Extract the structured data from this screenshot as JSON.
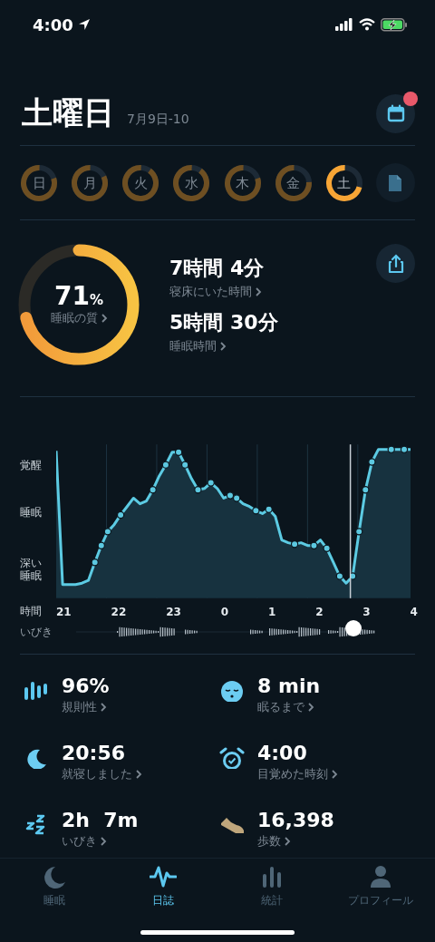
{
  "status_bar": {
    "time": "4:00"
  },
  "header": {
    "title": "土曜日",
    "date_range": "7月9日-10",
    "calendar_badge": true
  },
  "days": [
    {
      "label": "日",
      "selected": false
    },
    {
      "label": "月",
      "selected": false
    },
    {
      "label": "火",
      "selected": false
    },
    {
      "label": "水",
      "selected": false
    },
    {
      "label": "木",
      "selected": false
    },
    {
      "label": "金",
      "selected": false
    },
    {
      "label": "土",
      "selected": true
    }
  ],
  "summary": {
    "quality": {
      "value": "71",
      "unit": "%",
      "label": "睡眠の質"
    },
    "stats": [
      {
        "value": "7時間 4分",
        "label": "寝床にいた時間"
      },
      {
        "value": "5時間 30分",
        "label": "睡眠時間"
      }
    ]
  },
  "hypnogram": {
    "y_labels": [
      "覚醒",
      "睡眠",
      "深い睡眠"
    ],
    "x_title": "時間",
    "x_labels": [
      "21",
      "22",
      "23",
      "0",
      "1",
      "2",
      "3",
      "4"
    ],
    "snore_label": "いびき"
  },
  "metrics": [
    {
      "value": "96%",
      "label": "規則性"
    },
    {
      "value": "8 min",
      "label": "眠るまで"
    },
    {
      "value": "20:56",
      "label": "就寝しました"
    },
    {
      "value": "4:00",
      "label": "目覚めた時刻"
    },
    {
      "value": "2h  7m",
      "label": "いびき"
    },
    {
      "value": "16,398",
      "label": "歩数"
    }
  ],
  "tabs": [
    {
      "label": "睡眠",
      "selected": false
    },
    {
      "label": "日誌",
      "selected": true
    },
    {
      "label": "統計",
      "selected": false
    },
    {
      "label": "プロフィール",
      "selected": false
    }
  ]
}
